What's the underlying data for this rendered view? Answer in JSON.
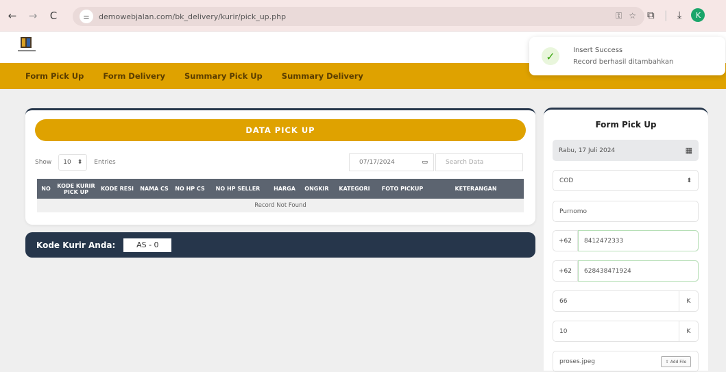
{
  "browser": {
    "url": "demowebjalan.com/bk_delivery/kurir/pick_up.php",
    "profile_initial": "K"
  },
  "menu": [
    "Form Pick Up",
    "Form Delivery",
    "Summary Pick Up",
    "Summary Delivery"
  ],
  "toast": {
    "title": "Insert Success",
    "message": "Record berhasil ditambahkan"
  },
  "table_card": {
    "title": "DATA PICK UP",
    "show_label": "Show",
    "entries_value": "10",
    "entries_label": "Entries",
    "date_value": "07/17/2024",
    "search_placeholder": "Search Data",
    "columns": [
      "NO",
      "KODE KURIR PICK UP",
      "KODE RESI",
      "NAMA CS",
      "NO HP CS",
      "NO HP SELLER",
      "HARGA",
      "ONGKIR",
      "KATEGORI",
      "FOTO PICKUP",
      "KETERANGAN"
    ],
    "empty_text": "Record Not Found"
  },
  "kode_kurir": {
    "label": "Kode Kurir Anda:",
    "value": "AS - 0"
  },
  "form": {
    "title": "Form Pick Up",
    "date": "Rabu, 17 Juli 2024",
    "kategori": "COD",
    "nama": "Purnomo",
    "phone_prefix": "+62",
    "hp_cs": "8412472333",
    "hp_seller": "628438471924",
    "harga": "66",
    "ongkir": "10",
    "unit": "K",
    "file_name": "proses.jpeg",
    "file_button": "Add File"
  }
}
